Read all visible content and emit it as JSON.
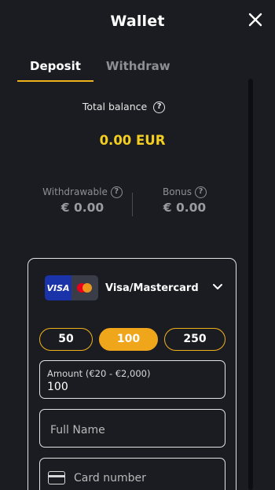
{
  "header": {
    "title": "Wallet"
  },
  "tabs": [
    {
      "label": "Deposit",
      "active": true
    },
    {
      "label": "Withdraw",
      "active": false
    }
  ],
  "balance": {
    "total_label": "Total balance",
    "total_amount": "0.00 EUR",
    "withdrawable_label": "Withdrawable",
    "withdrawable_amount": "€ 0.00",
    "bonus_label": "Bonus",
    "bonus_amount": "€ 0.00",
    "help_glyph": "?"
  },
  "payment": {
    "method_label": "Visa/Mastercard",
    "visa_text": "VISA",
    "quick_amounts": [
      "50",
      "100",
      "250"
    ],
    "selected_quick_amount": "100",
    "amount_label": "Amount (€20 - €2,000)",
    "amount_value": "100",
    "full_name_placeholder": "Full Name",
    "card_number_placeholder": "Card number"
  },
  "colors": {
    "background": "#1b1c22",
    "accent": "#f0b21a",
    "total_amount": "#f5cf1f"
  },
  "icons": [
    "close-icon",
    "help-icon",
    "chevron-down-icon",
    "credit-card-icon",
    "visa-logo",
    "mastercard-logo"
  ]
}
